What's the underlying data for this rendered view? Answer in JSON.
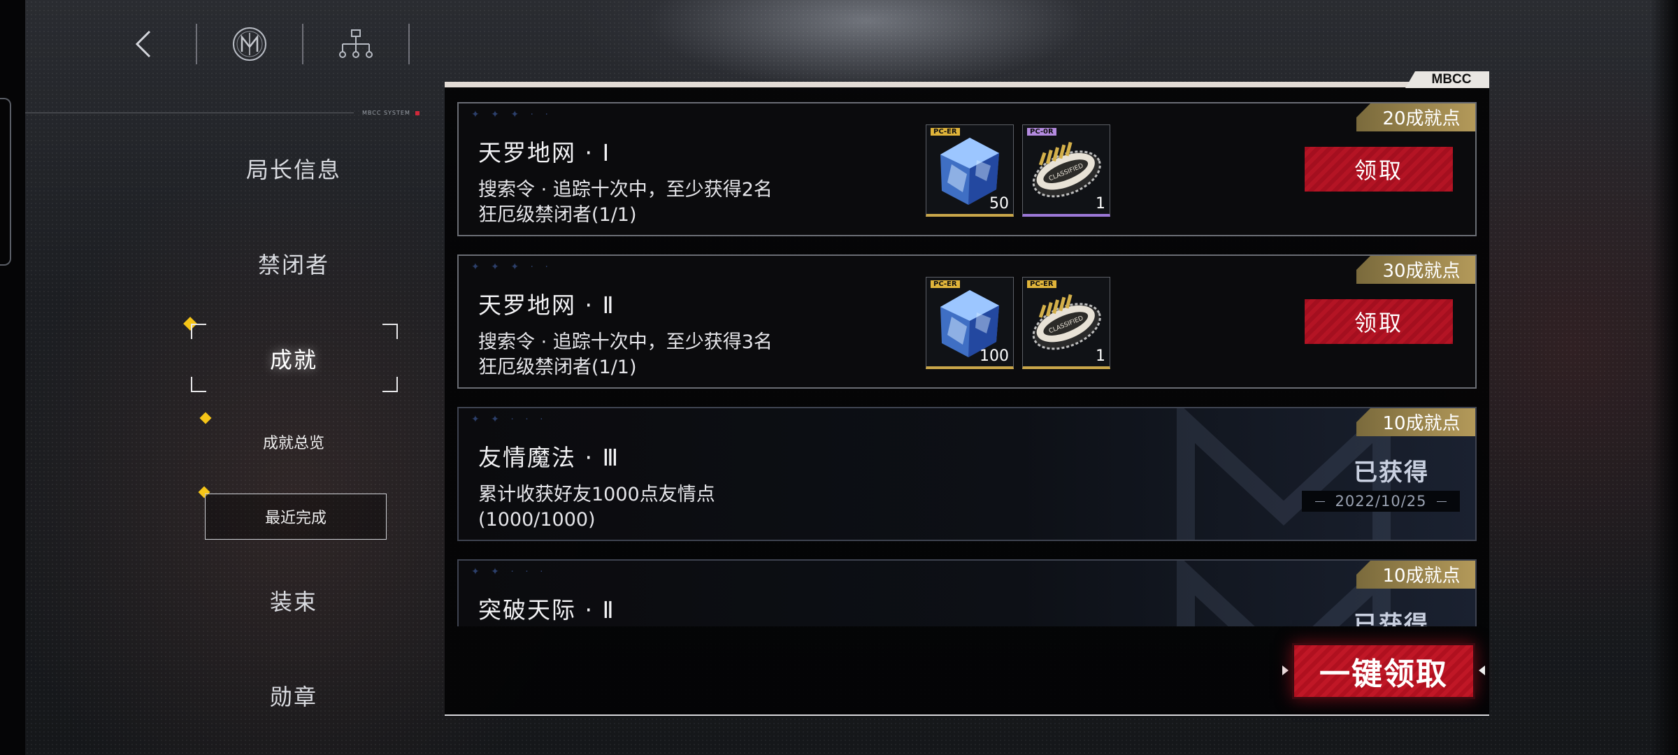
{
  "topnav": {
    "back_icon": "chevron-left-icon",
    "logo_icon": "mbcc-logo-icon",
    "tree_icon": "hierarchy-icon"
  },
  "header": {
    "system_label": "MBCC SYSTEM"
  },
  "panel": {
    "tag": "MBCC"
  },
  "sidebar": {
    "items": [
      {
        "label": "局长信息"
      },
      {
        "label": "禁闭者"
      },
      {
        "label": "成就",
        "selected": true
      },
      {
        "label": "装束"
      },
      {
        "label": "勋章"
      }
    ],
    "subitems": [
      {
        "label": "成就总览"
      },
      {
        "label": "最近完成",
        "selected": true
      }
    ]
  },
  "achievements": [
    {
      "title": "天罗地网 · Ⅰ",
      "desc_line1": "搜索令 · 追踪十次中，至少获得2名",
      "desc_line2": "狂厄级禁闭者(1/1)",
      "points": "20成就点",
      "rewards": [
        {
          "label": "PC-ER",
          "count": "50",
          "icon": "crystal-cube-icon",
          "color": "#e0b43a"
        },
        {
          "label": "PC-0R",
          "count": "1",
          "icon": "classified-badge-icon",
          "color": "#b48be0"
        }
      ],
      "action": "领取"
    },
    {
      "title": "天罗地网 · Ⅱ",
      "desc_line1": "搜索令 · 追踪十次中，至少获得3名",
      "desc_line2": "狂厄级禁闭者(1/1)",
      "points": "30成就点",
      "rewards": [
        {
          "label": "PC-ER",
          "count": "100",
          "icon": "crystal-cube-icon",
          "color": "#e0b43a"
        },
        {
          "label": "PC-ER",
          "count": "1",
          "icon": "classified-badge-icon",
          "color": "#e0b43a"
        }
      ],
      "action": "领取"
    },
    {
      "title": "友情魔法 · Ⅲ",
      "desc_line1": "累计收获好友1000点友情点",
      "desc_line2": "(1000/1000)",
      "points": "10成就点",
      "status": "已获得",
      "date": "2022/10/25"
    },
    {
      "title": "突破天际 · Ⅱ",
      "points": "10成就点",
      "status": "已获得"
    }
  ],
  "footer": {
    "claim_all": "一键领取"
  }
}
